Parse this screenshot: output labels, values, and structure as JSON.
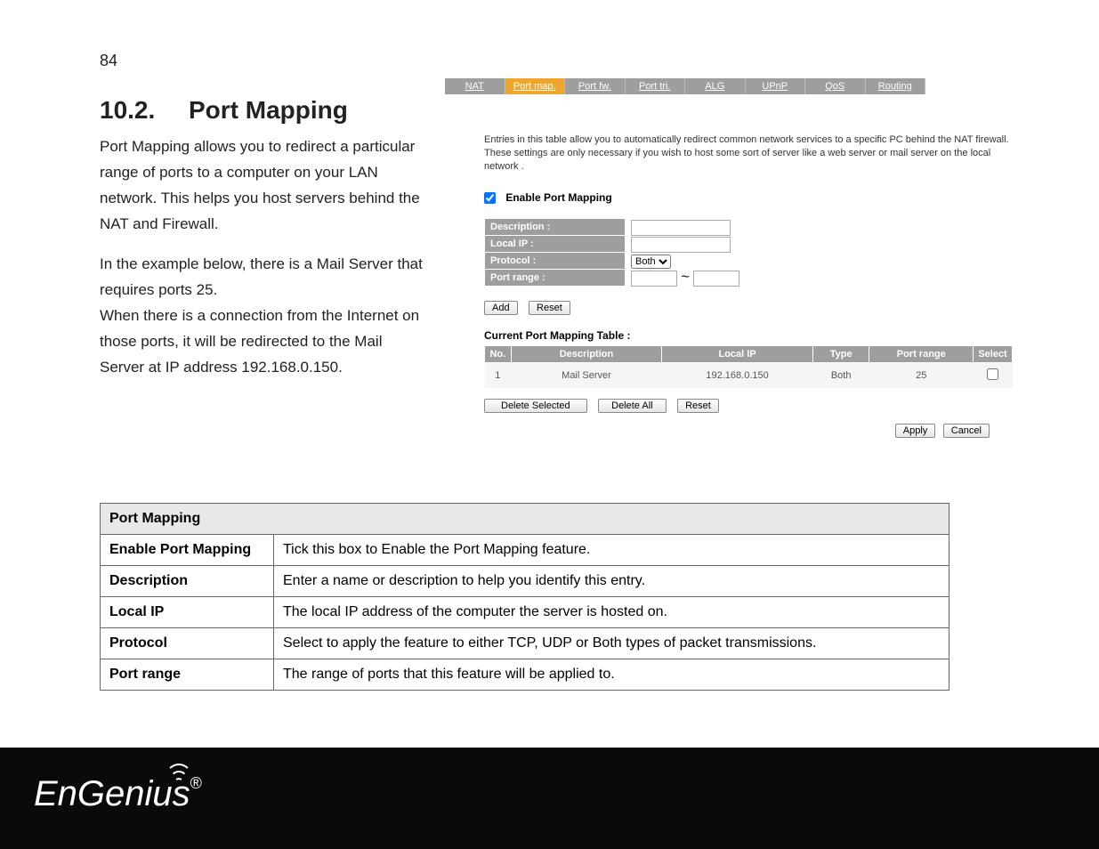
{
  "page_number": "84",
  "section": {
    "number": "10.2.",
    "title": "Port Mapping"
  },
  "paragraph1": "Port Mapping allows you to redirect a particular range of ports to a computer on your LAN network. This helps you host servers behind the NAT and Firewall.",
  "paragraph2": "In the example below, there is a Mail Server that requires ports 25.\nWhen there is a connection from the Internet on those ports, it will be redirected to the Mail Server at IP address 192.168.0.150.",
  "screenshot": {
    "tabs": [
      "NAT",
      "Port map.",
      "Port fw.",
      "Port tri.",
      "ALG",
      "UPnP",
      "QoS",
      "Routing"
    ],
    "active_tab": 1,
    "intro": "Entries in this table allow you to automatically redirect common network services to a specific PC behind the NAT firewall. These settings are only necessary if you wish to host some sort of server like a web server or mail server on the local network .",
    "enable_label": "Enable Port Mapping",
    "enable_checked": true,
    "form": {
      "description_label": "Description :",
      "local_ip_label": "Local IP :",
      "protocol_label": "Protocol :",
      "protocol_value": "Both",
      "port_range_label": "Port range :",
      "range_sep": "~"
    },
    "buttons": {
      "add": "Add",
      "reset": "Reset",
      "delete_selected": "Delete Selected",
      "delete_all": "Delete All",
      "reset2": "Reset",
      "apply": "Apply",
      "cancel": "Cancel"
    },
    "table_title": "Current Port Mapping Table :",
    "table_headers": [
      "No.",
      "Description",
      "Local IP",
      "Type",
      "Port range",
      "Select"
    ],
    "table_row": {
      "no": "1",
      "desc": "Mail Server",
      "ip": "192.168.0.150",
      "type": "Both",
      "range": "25"
    }
  },
  "desc_table": {
    "header": "Port Mapping",
    "rows": [
      {
        "label": "Enable Port Mapping",
        "text": "Tick this box to Enable the Port Mapping feature."
      },
      {
        "label": "Description",
        "text": "Enter a name or description to help you identify this entry."
      },
      {
        "label": "Local IP",
        "text": "The local IP address of the computer the server is hosted on."
      },
      {
        "label": "Protocol",
        "text": "Select to apply the feature to either TCP, UDP or Both types of packet transmissions."
      },
      {
        "label": "Port range",
        "text": "The range of ports that this feature will be applied to."
      }
    ]
  },
  "logo_text": "EnGenius",
  "logo_reg": "®"
}
